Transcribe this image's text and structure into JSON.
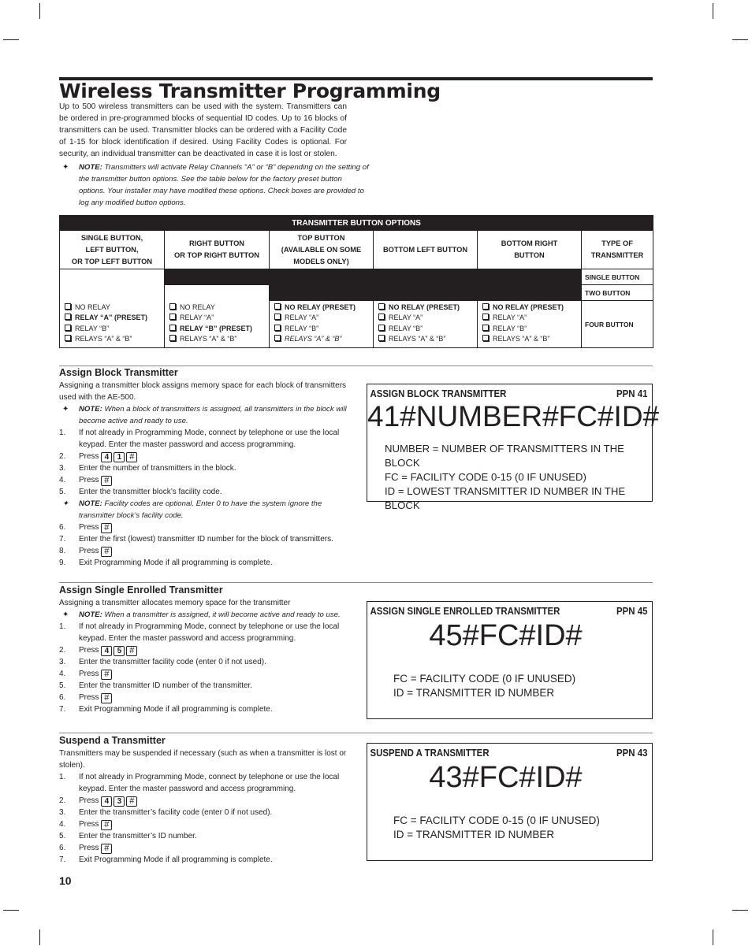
{
  "page": {
    "title": "Wireless Transmitter Programming",
    "intro": "Up to 500 wireless transmitters can be used with the system. Transmitters can be ordered in pre-programmed blocks of sequential ID codes. Up to 16 blocks of transmitters can be used. Transmitter blocks can be ordered with a Facility Code of 1-15 for block identification if desired. Using Facility Codes is optional. For security, an individual transmitter can be deactivated in case it is lost or stolen.",
    "intro_note_label": "NOTE:",
    "intro_note_text": " Transmitters will activate Relay Channels “A” or “B” depending on the setting of the transmitter button options. See the table below for the factory preset button options. Your installer may have modified these options. Check boxes are provided to log any modified button options.",
    "page_number": "10",
    "note_symbol": "✦"
  },
  "table": {
    "title": "TRANSMITTER BUTTON OPTIONS",
    "columns": [
      "SINGLE BUTTON,\nLEFT BUTTON,\nOR TOP LEFT BUTTON",
      "RIGHT BUTTON\nOR TOP RIGHT BUTTON",
      "TOP BUTTON\n(AVAILABLE ON SOME\nMODELS ONLY)",
      "BOTTOM LEFT BUTTON",
      "BOTTOM RIGHT\nBUTTON",
      "TYPE OF\nTRANSMITTER"
    ],
    "types": [
      "SINGLE BUTTON",
      "TWO BUTTON",
      "FOUR BUTTON"
    ],
    "options": [
      [
        {
          "label": "NO RELAY",
          "style": "normal"
        },
        {
          "label": "RELAY “A” (PRESET)",
          "style": "bold"
        },
        {
          "label": "RELAY “B”",
          "style": "normal"
        },
        {
          "label": "RELAYS “A” & “B”",
          "style": "normal"
        }
      ],
      [
        {
          "label": "NO RELAY",
          "style": "normal"
        },
        {
          "label": "RELAY “A”",
          "style": "normal"
        },
        {
          "label": "RELAY “B” (PRESET)",
          "style": "bold"
        },
        {
          "label": "RELAYS “A” & “B”",
          "style": "normal"
        }
      ],
      [
        {
          "label": "NO RELAY (PRESET)",
          "style": "bold"
        },
        {
          "label": "RELAY “A”",
          "style": "normal"
        },
        {
          "label": "RELAY “B”",
          "style": "normal"
        },
        {
          "label": "RELAYS “A” & “B”",
          "style": "italic"
        }
      ],
      [
        {
          "label": "NO RELAY (PRESET)",
          "style": "bold"
        },
        {
          "label": "RELAY “A”",
          "style": "normal"
        },
        {
          "label": "RELAY “B”",
          "style": "normal"
        },
        {
          "label": "RELAYS “A” & “B”",
          "style": "normal"
        }
      ],
      [
        {
          "label": "NO RELAY (PRESET)",
          "style": "bold"
        },
        {
          "label": "RELAY “A”",
          "style": "normal"
        },
        {
          "label": "RELAY “B”",
          "style": "normal"
        },
        {
          "label": "RELAYS “A” & “B”",
          "style": "normal"
        }
      ]
    ]
  },
  "sections": {
    "block": {
      "title": "Assign Block Transmitter",
      "desc": "Assigning a transmitter block assigns memory space for each block of transmitters used with the AE-500.",
      "note_label": "NOTE:",
      "note_text": " When a block of transmitters is assigned, all transmitters in the block will become active and ready to use.",
      "steps": [
        {
          "n": "1.",
          "text": "If not already in Programming Mode, connect by telephone or use the local keypad. Enter the master password and access programming."
        },
        {
          "n": "2.",
          "text": "Press",
          "keys": [
            "4",
            "1",
            "#"
          ]
        },
        {
          "n": "3.",
          "text": "Enter the number of transmitters in the block."
        },
        {
          "n": "4.",
          "text": "Press",
          "keys": [
            "#"
          ]
        },
        {
          "n": "5.",
          "text": "Enter the transmitter block’s facility code."
        },
        {
          "n": "✦",
          "note": true,
          "label": "NOTE:",
          "text": " Facility codes are optional. Enter 0 to have the system ignore the transmitter block’s facility code."
        },
        {
          "n": "6.",
          "text": "Press",
          "keys": [
            "#"
          ]
        },
        {
          "n": "7.",
          "text": "Enter the first (lowest) transmitter ID number for the block of transmitters."
        },
        {
          "n": "8.",
          "text": "Press",
          "keys": [
            "#"
          ]
        },
        {
          "n": "9.",
          "text": "Exit Programming Mode if all programming is complete."
        }
      ],
      "box": {
        "title": "ASSIGN BLOCK TRANSMITTER",
        "ppn": "PPN 41",
        "code": "41#NUMBER#FC#ID#",
        "legend": [
          "NUMBER = NUMBER OF TRANSMITTERS IN THE BLOCK",
          "FC = FACILITY CODE 0-15 (0 IF UNUSED)",
          "ID = LOWEST TRANSMITTER ID NUMBER IN THE BLOCK"
        ]
      }
    },
    "single": {
      "title": "Assign Single Enrolled Transmitter",
      "desc": "Assigning a transmitter allocates memory space for the transmitter",
      "note_label": "NOTE:",
      "note_text": " When a transmitter is assigned, it will become active and ready to use.",
      "steps": [
        {
          "n": "1.",
          "text": "If not already in Programming Mode, connect by telephone or use the local keypad. Enter the master password and access programming."
        },
        {
          "n": "2.",
          "text": "Press",
          "keys": [
            "4",
            "5",
            "#"
          ]
        },
        {
          "n": "3.",
          "text": "Enter the transmitter facility code (enter 0 if not used)."
        },
        {
          "n": "4.",
          "text": "Press",
          "keys": [
            "#"
          ]
        },
        {
          "n": "5.",
          "text": "Enter the transmitter ID number of the transmitter."
        },
        {
          "n": "6.",
          "text": "Press",
          "keys": [
            "#"
          ]
        },
        {
          "n": "7.",
          "text": "Exit Programming Mode if all programming is complete."
        }
      ],
      "box": {
        "title": "ASSIGN SINGLE ENROLLED TRANSMITTER",
        "ppn": "PPN 45",
        "code": "45#FC#ID#",
        "legend": [
          "FC = FACILITY CODE (0 IF UNUSED)",
          "ID = TRANSMITTER ID NUMBER"
        ]
      }
    },
    "suspend": {
      "title": "Suspend a Transmitter",
      "desc": "Transmitters may be suspended if necessary (such as when a transmitter is lost or stolen).",
      "steps": [
        {
          "n": "1.",
          "text": "If not already in Programming Mode, connect by telephone or use the local keypad. Enter the master password and access programming."
        },
        {
          "n": "2.",
          "text": "Press",
          "keys": [
            "4",
            "3",
            "#"
          ]
        },
        {
          "n": "3.",
          "text": "Enter the transmitter’s facility code (enter 0 if not used)."
        },
        {
          "n": "4.",
          "text": "Press",
          "keys": [
            "#"
          ]
        },
        {
          "n": "5.",
          "text": "Enter the transmitter’s ID number."
        },
        {
          "n": "6.",
          "text": "Press",
          "keys": [
            "#"
          ]
        },
        {
          "n": "7.",
          "text": "Exit Programming Mode if all programming is complete."
        }
      ],
      "box": {
        "title": "SUSPEND A TRANSMITTER",
        "ppn": "PPN 43",
        "code": "43#FC#ID#",
        "legend": [
          "FC = FACILITY CODE 0-15 (0 IF UNUSED)",
          "ID = TRANSMITTER ID NUMBER"
        ]
      }
    }
  }
}
